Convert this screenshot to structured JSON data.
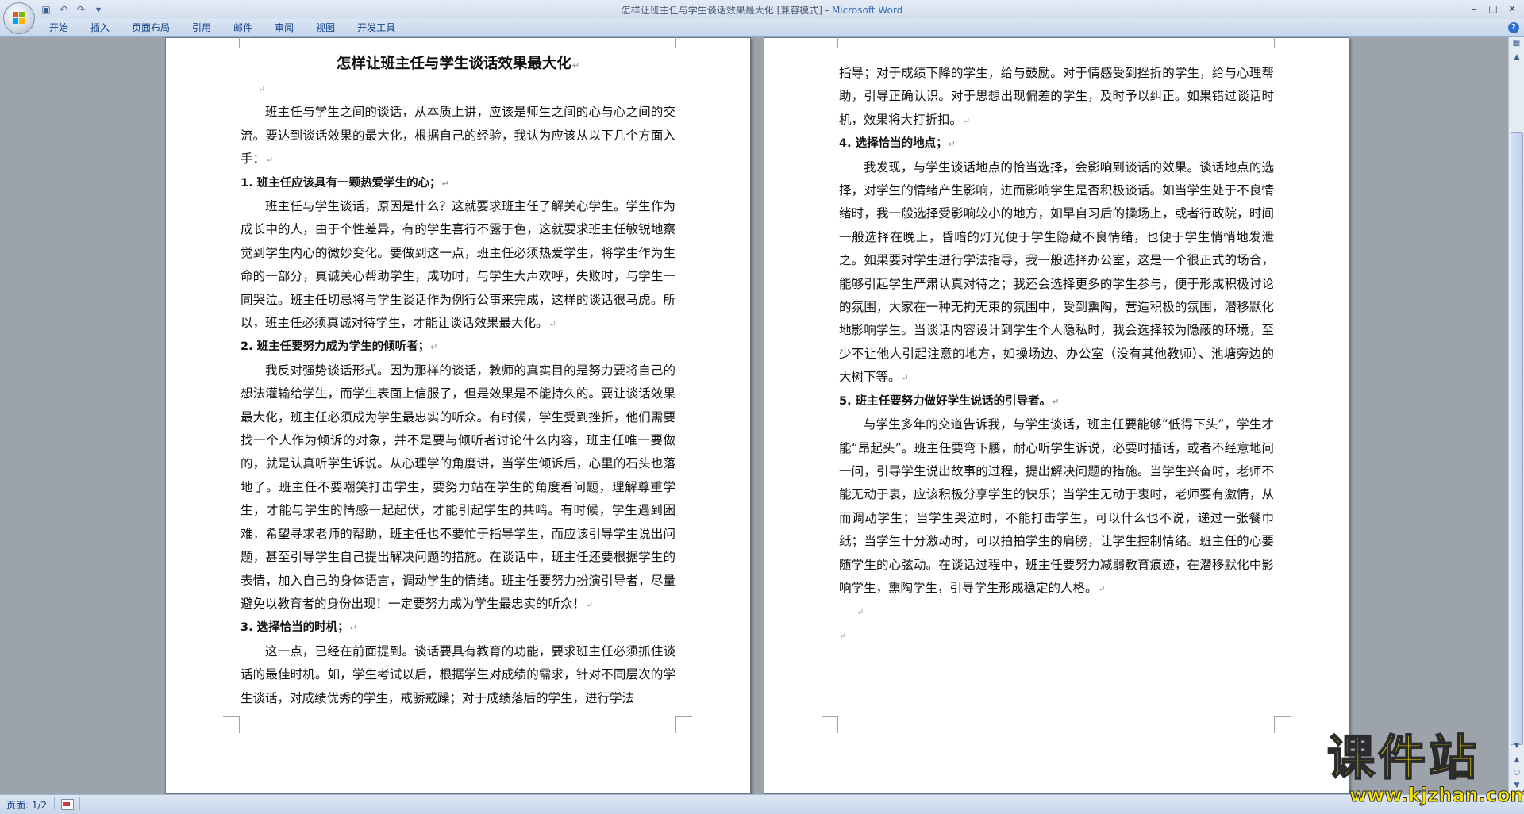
{
  "window": {
    "doc_title": "怎样让班主任与学生谈话效果最大化 [兼容模式]",
    "separator": " - ",
    "app_name": "Microsoft Word"
  },
  "icons": {
    "office": "office-button-icon",
    "save": "save-icon",
    "undo": "undo-icon",
    "redo": "redo-icon",
    "customize": "customize-qat-icon",
    "help": "help-icon"
  },
  "ribbon": {
    "tabs": [
      "开始",
      "插入",
      "页面布局",
      "引用",
      "邮件",
      "审阅",
      "视图",
      "开发工具"
    ]
  },
  "document": {
    "title": "怎样让班主任与学生谈话效果最大化",
    "page1": {
      "intro": "班主任与学生之间的谈话，从本质上讲，应该是师生之间的心与心之间的交流。要达到谈话效果的最大化，根据自己的经验，我认为应该从以下几个方面入手：",
      "h1": "1. 班主任应该具有一颗热爱学生的心；",
      "p1": "班主任与学生谈话，原因是什么？这就要求班主任了解关心学生。学生作为成长中的人，由于个性差异，有的学生喜行不露于色，这就要求班主任敏锐地察觉到学生内心的微妙变化。要做到这一点，班主任必须热爱学生，将学生作为生命的一部分，真诚关心帮助学生，成功时，与学生大声欢呼，失败时，与学生一同哭泣。班主任切忌将与学生谈话作为例行公事来完成，这样的谈话很马虎。所以，班主任必须真诚对待学生，才能让谈话效果最大化。",
      "h2": "2. 班主任要努力成为学生的倾听者；",
      "p2": "我反对强势谈话形式。因为那样的谈话，教师的真实目的是努力要将自己的想法灌输给学生，而学生表面上信服了，但是效果是不能持久的。要让谈话效果最大化，班主任必须成为学生最忠实的听众。有时候，学生受到挫折，他们需要找一个人作为倾诉的对象，并不是要与倾听者讨论什么内容，班主任唯一要做的，就是认真听学生诉说。从心理学的角度讲，当学生倾诉后，心里的石头也落地了。班主任不要嘲笑打击学生，要努力站在学生的角度看问题，理解尊重学生，才能与学生的情感一起起伏，才能引起学生的共鸣。有时候，学生遇到困难，希望寻求老师的帮助，班主任也不要忙于指导学生，而应该引导学生说出问题，甚至引导学生自己提出解决问题的措施。在谈话中，班主任还要根据学生的表情，加入自己的身体语言，调动学生的情绪。班主任要努力扮演引导者，尽量避免以教育者的身份出现！一定要努力成为学生最忠实的听众！",
      "h3": "3. 选择恰当的时机；",
      "p3": "这一点，已经在前面提到。谈话要具有教育的功能，要求班主任必须抓住谈话的最佳时机。如，学生考试以后，根据学生对成绩的需求，针对不同层次的学生谈话，对成绩优秀的学生，戒骄戒躁；对于成绩落后的学生，进行学法"
    },
    "page2": {
      "p3_cont": "指导；对于成绩下降的学生，给与鼓励。对于情感受到挫折的学生，给与心理帮助，引导正确认识。对于思想出现偏差的学生，及时予以纠正。如果错过谈话时机，效果将大打折扣。",
      "h4": "4. 选择恰当的地点；",
      "p4": "我发现，与学生谈话地点的恰当选择，会影响到谈话的效果。谈话地点的选择，对学生的情绪产生影响，进而影响学生是否积极谈话。如当学生处于不良情绪时，我一般选择受影响较小的地方，如早自习后的操场上，或者行政院，时间一般选择在晚上，昏暗的灯光便于学生隐藏不良情绪，也便于学生悄悄地发泄之。如果要对学生进行学法指导，我一般选择办公室，这是一个很正式的场合，能够引起学生严肃认真对待之；我还会选择更多的学生参与，便于形成积极讨论的氛围，大家在一种无拘无束的氛围中，受到熏陶，营造积极的氛围，潜移默化地影响学生。当谈话内容设计到学生个人隐私时，我会选择较为隐蔽的环境，至少不让他人引起注意的地方，如操场边、办公室（没有其他教师）、池塘旁边的大树下等。",
      "h5": "5. 班主任要努力做好学生说话的引导者。",
      "p5": "与学生多年的交道告诉我，与学生谈话，班主任要能够“低得下头”，学生才能“昂起头”。班主任要弯下腰，耐心听学生诉说，必要时插话，或者不经意地问一问，引导学生说出故事的过程，提出解决问题的措施。当学生兴奋时，老师不能无动于衷，应该积极分享学生的快乐；当学生无动于衷时，老师要有激情，从而调动学生；当学生哭泣时，不能打击学生，可以什么也不说，递过一张餐巾纸；当学生十分激动时，可以拍拍学生的肩膀，让学生控制情绪。班主任的心要随学生的心弦动。在谈话过程中，班主任要努力减弱教育痕迹，在潜移默化中影响学生，熏陶学生，引导学生形成稳定的人格。"
    },
    "paragraph_mark": "↵"
  },
  "statusbar": {
    "page_info": "页面: 1/2"
  },
  "watermark": {
    "title": "课件站",
    "url": "www.kjzhan.com"
  }
}
